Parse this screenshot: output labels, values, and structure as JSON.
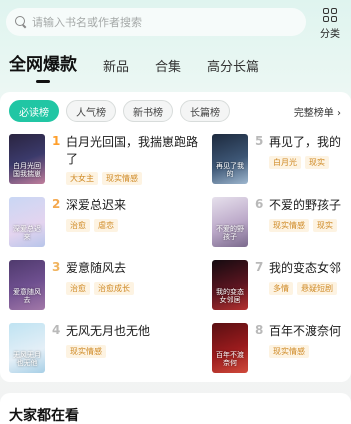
{
  "search": {
    "placeholder": "请输入书名或作者搜索"
  },
  "category": {
    "label": "分类",
    "icon": "grid-icon"
  },
  "tabs": [
    {
      "label": "全网爆款",
      "active": true
    },
    {
      "label": "新品"
    },
    {
      "label": "合集"
    },
    {
      "label": "高分长篇"
    }
  ],
  "chips": [
    {
      "label": "必读榜",
      "active": true
    },
    {
      "label": "人气榜"
    },
    {
      "label": "新书榜"
    },
    {
      "label": "长篇榜"
    }
  ],
  "full_rank": "完整榜单 ›",
  "rank_colors": {
    "1": "#ff9f2b",
    "2": "#f4a84e",
    "3": "#f0b35e",
    "rest": "#b9b9b9"
  },
  "books": [
    {
      "rank": "1",
      "title": "白月光回国，我揣崽跑路了",
      "tags": [
        "大女主",
        "现实情感"
      ],
      "cover_text": "白月光回国我揣崽"
    },
    {
      "rank": "2",
      "title": "深爱总迟来",
      "tags": [
        "治愈",
        "虐恋"
      ],
      "cover_text": "深爱总迟来"
    },
    {
      "rank": "3",
      "title": "爱意随风去",
      "tags": [
        "治愈",
        "治愈成长"
      ],
      "cover_text": "爱意随风去"
    },
    {
      "rank": "4",
      "title": "无风无月也无他",
      "tags": [
        "现实情感"
      ],
      "cover_text": "无风无月也无他"
    },
    {
      "rank": "5",
      "title": "再见了，我的",
      "tags": [
        "白月光",
        "现实"
      ],
      "cover_text": "再见了我的"
    },
    {
      "rank": "6",
      "title": "不爱的野孩子",
      "tags": [
        "现实情感",
        "现实"
      ],
      "cover_text": "不爱的野孩子"
    },
    {
      "rank": "7",
      "title": "我的变态女邻",
      "tags": [
        "多情",
        "悬疑短剧"
      ],
      "cover_text": "我的变态女邻居"
    },
    {
      "rank": "8",
      "title": "百年不渡奈何",
      "tags": [
        "现实情感"
      ],
      "cover_text": "百年不渡奈何"
    }
  ],
  "section2": {
    "title": "大家都在看"
  }
}
